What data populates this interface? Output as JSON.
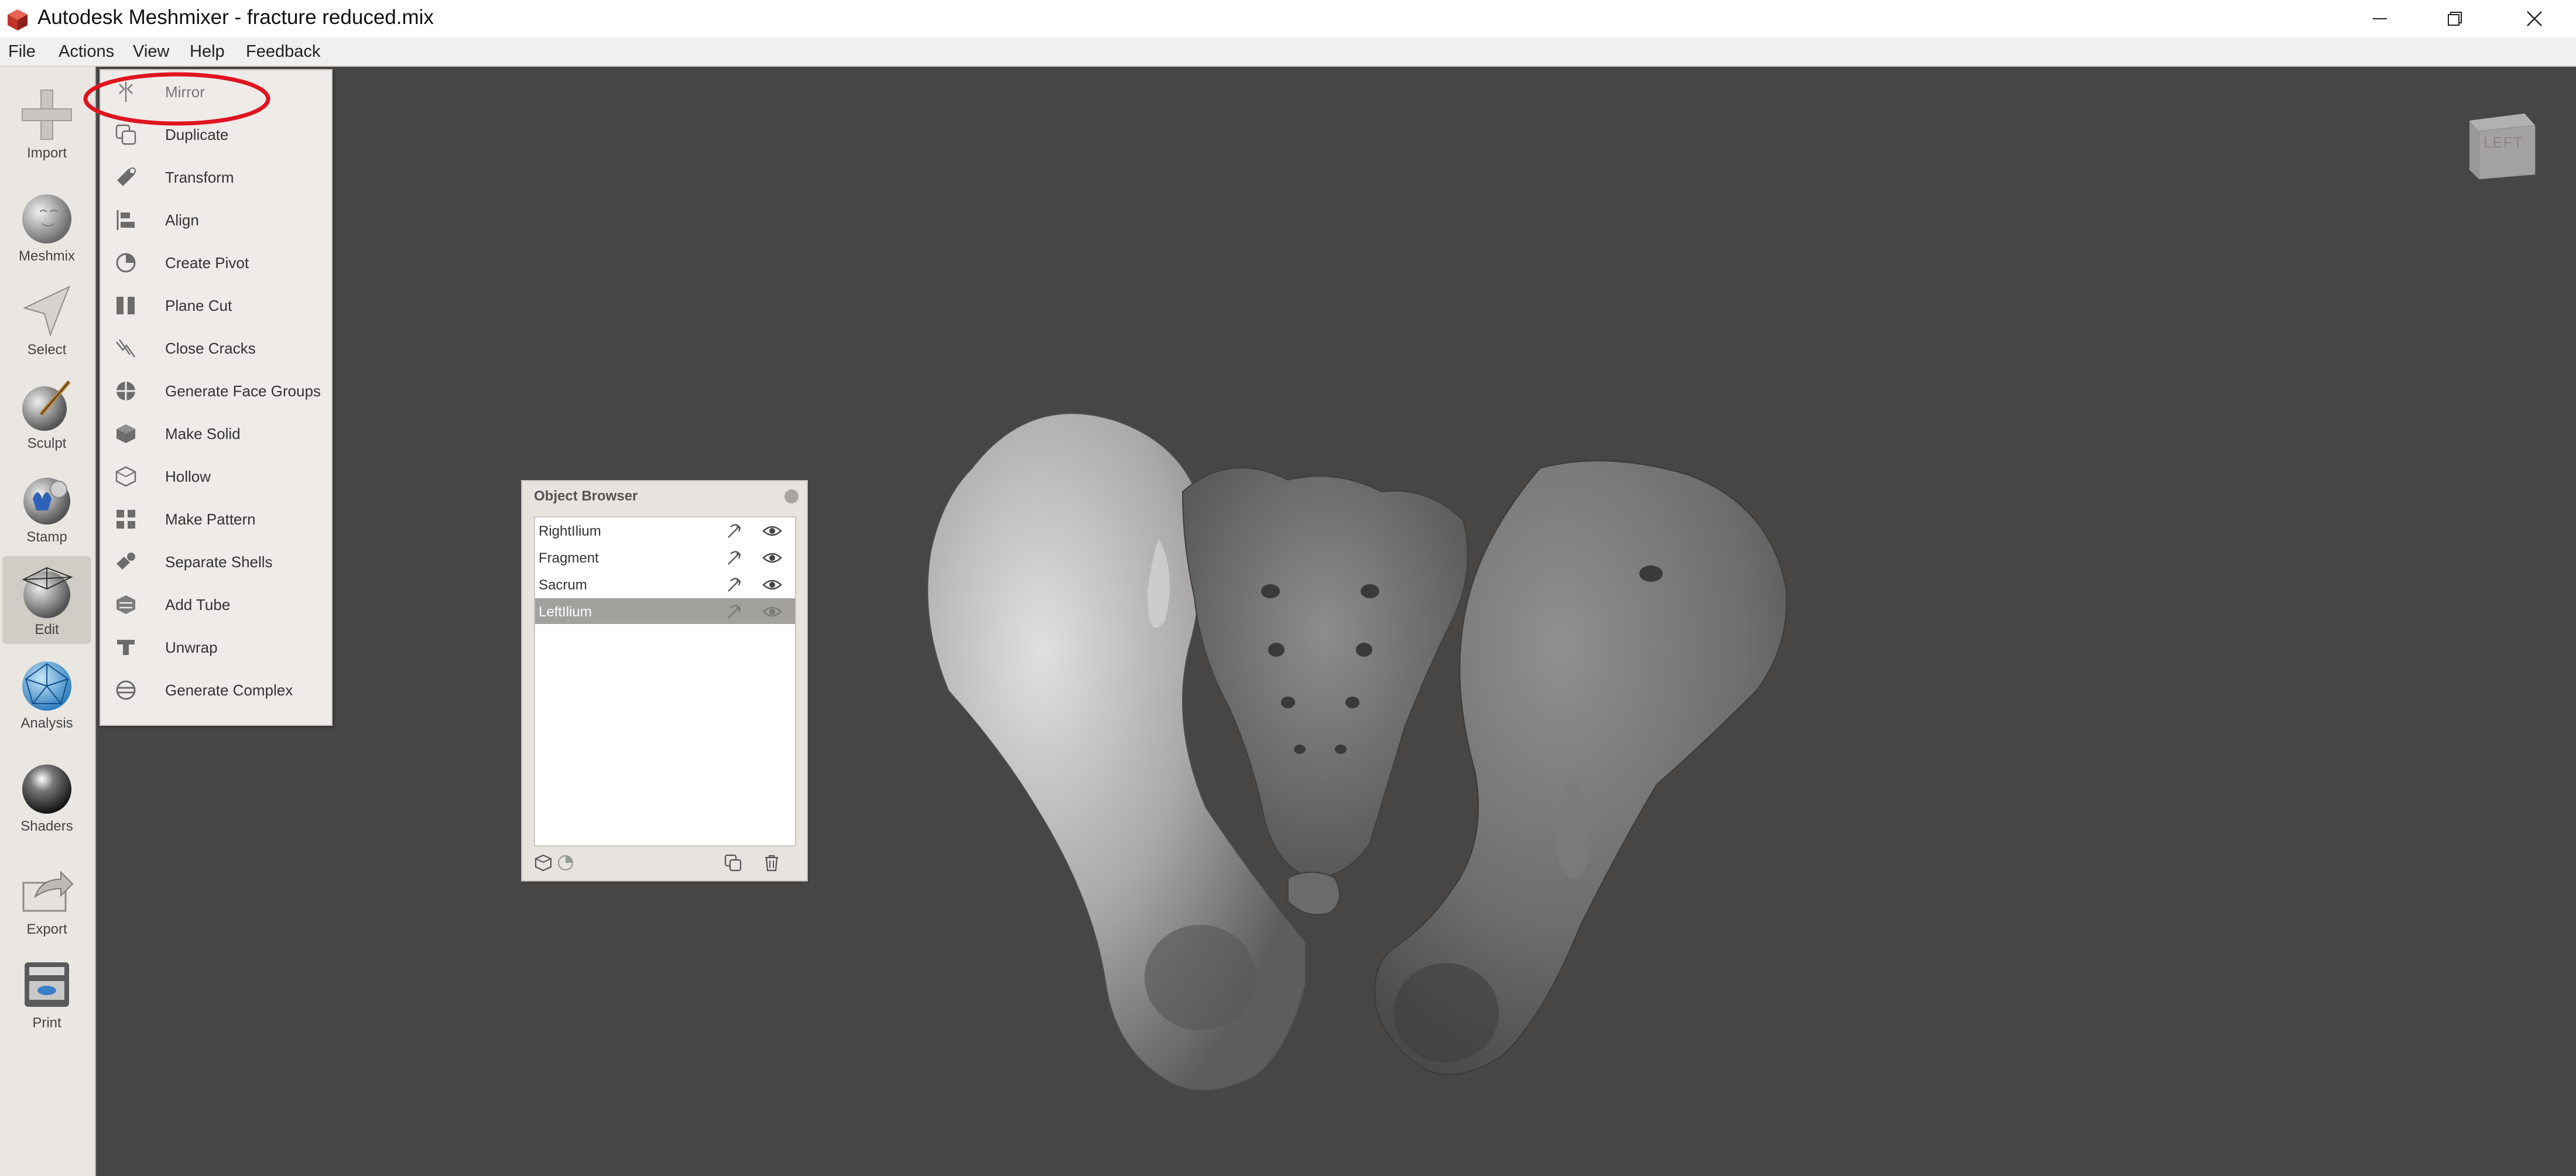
{
  "window": {
    "title": "Autodesk Meshmixer - fracture reduced.mix"
  },
  "menubar": {
    "items": [
      "File",
      "Actions",
      "View",
      "Help",
      "Feedback"
    ]
  },
  "toolbar": {
    "tools": [
      {
        "label": "Import",
        "icon": "plus-icon"
      },
      {
        "label": "Meshmix",
        "icon": "bunny-sphere-icon"
      },
      {
        "label": "Select",
        "icon": "cursor-arrow-icon"
      },
      {
        "label": "Sculpt",
        "icon": "sculpt-brush-icon"
      },
      {
        "label": "Stamp",
        "icon": "stamp-icon"
      },
      {
        "label": "Edit",
        "icon": "edit-mesh-icon",
        "active": true
      },
      {
        "label": "Analysis",
        "icon": "analysis-mesh-icon"
      },
      {
        "label": "Shaders",
        "icon": "shader-sphere-icon"
      },
      {
        "label": "Export",
        "icon": "export-icon"
      },
      {
        "label": "Print",
        "icon": "printer-icon"
      }
    ]
  },
  "edit_menu": {
    "items": [
      {
        "label": "Mirror",
        "icon": "mirror-icon"
      },
      {
        "label": "Duplicate",
        "icon": "duplicate-icon"
      },
      {
        "label": "Transform",
        "icon": "transform-icon"
      },
      {
        "label": "Align",
        "icon": "align-icon"
      },
      {
        "label": "Create Pivot",
        "icon": "pivot-icon"
      },
      {
        "label": "Plane Cut",
        "icon": "plane-cut-icon"
      },
      {
        "label": "Close Cracks",
        "icon": "close-cracks-icon"
      },
      {
        "label": "Generate Face Groups",
        "icon": "face-groups-icon"
      },
      {
        "label": "Make Solid",
        "icon": "make-solid-icon"
      },
      {
        "label": "Hollow",
        "icon": "hollow-icon"
      },
      {
        "label": "Make Pattern",
        "icon": "pattern-icon"
      },
      {
        "label": "Separate Shells",
        "icon": "separate-shells-icon"
      },
      {
        "label": "Add Tube",
        "icon": "tube-icon"
      },
      {
        "label": "Unwrap",
        "icon": "unwrap-icon"
      },
      {
        "label": "Generate Complex",
        "icon": "complex-icon"
      }
    ],
    "highlight_color": "#e0141e"
  },
  "object_browser": {
    "title": "Object Browser",
    "objects": [
      {
        "name": "RightIlium",
        "selected": false
      },
      {
        "name": "Fragment",
        "selected": false
      },
      {
        "name": "Sacrum",
        "selected": false
      },
      {
        "name": "LeftIlium",
        "selected": true
      }
    ]
  },
  "viewport": {
    "background": "#474645",
    "nav_cube_label": "LEFT"
  }
}
